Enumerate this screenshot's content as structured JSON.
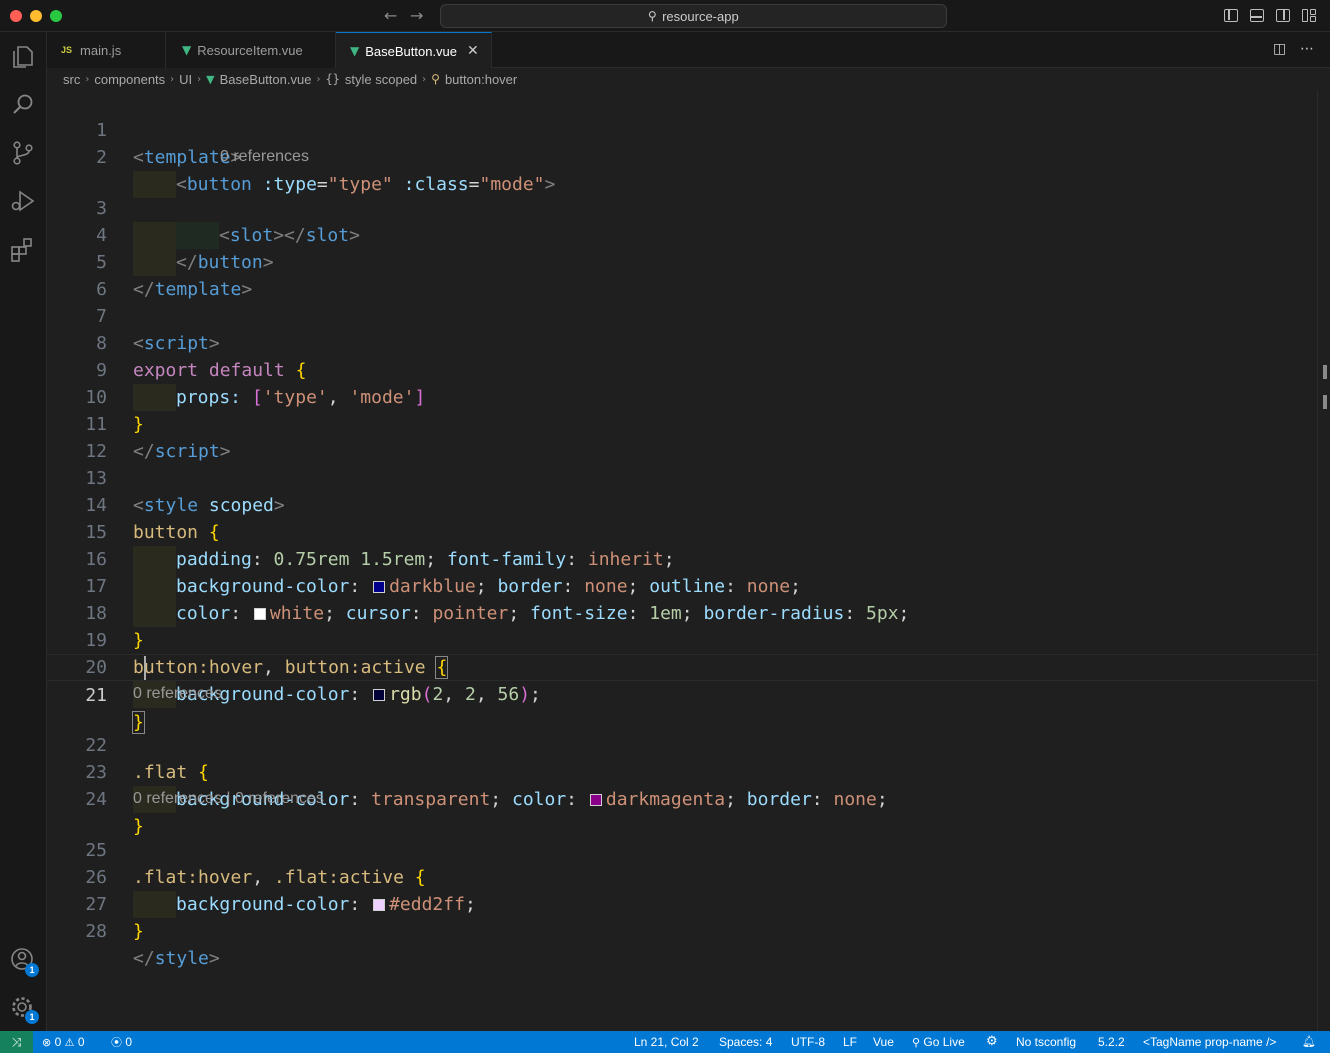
{
  "window": {
    "search_text": "resource-app"
  },
  "tabs": [
    {
      "label": "main.js",
      "icon": "js-icon",
      "badge": "JS"
    },
    {
      "label": "ResourceItem.vue",
      "icon": "vue-icon"
    },
    {
      "label": "BaseButton.vue",
      "icon": "vue-icon",
      "active": true
    }
  ],
  "breadcrumb": {
    "items": [
      "src",
      "components",
      "UI",
      "BaseButton.vue",
      "style scoped",
      "button:hover"
    ],
    "brace_glyph": "{}"
  },
  "codelens": {
    "line2": "0 references",
    "line21": "0 references",
    "line24": "0 references | 0 references"
  },
  "line_numbers": [
    "1",
    "2",
    "3",
    "4",
    "5",
    "6",
    "7",
    "8",
    "9",
    "10",
    "11",
    "12",
    "13",
    "14",
    "15",
    "16",
    "17",
    "18",
    "19",
    "20",
    "21",
    "22",
    "23",
    "24",
    "25",
    "26",
    "27",
    "28"
  ],
  "code": {
    "l1": {
      "lt": "<",
      "tag": "template",
      "gt": ">"
    },
    "l2": {
      "lt": "<",
      "tag": "button",
      "a1": ":type",
      "eq1": "=",
      "v1": "\"type\"",
      "a2": ":class",
      "eq2": "=",
      "v2": "\"mode\"",
      "gt": ">"
    },
    "l3": {
      "lt": "<",
      "tag": "slot",
      "mid": "></",
      "tag2": "slot",
      "gt": ">"
    },
    "l4": {
      "lt": "</",
      "tag": "button",
      "gt": ">"
    },
    "l5": {
      "lt": "</",
      "tag": "template",
      "gt": ">"
    },
    "l7": {
      "lt": "<",
      "tag": "script",
      "gt": ">"
    },
    "l8": {
      "kw": "export default",
      "brace": "{"
    },
    "l9": {
      "prop": "props:",
      "open": "[",
      "s1": "'type'",
      "comma": ",",
      "s2": "'mode'",
      "close": "]"
    },
    "l10": {
      "brace": "}"
    },
    "l11": {
      "lt": "</",
      "tag": "script",
      "gt": ">"
    },
    "l13": {
      "lt": "<",
      "tag": "style",
      "attr": "scoped",
      "gt": ">"
    },
    "l14": {
      "sel": "button",
      "brace": "{"
    },
    "l15": {
      "p1": "padding",
      "v1a": "0.75rem",
      "v1b": "1.5rem",
      "p2": "font-family",
      "v2": "inherit"
    },
    "l16": {
      "p1": "background-color",
      "v1": "darkblue",
      "p2": "border",
      "v2": "none",
      "p3": "outline",
      "v3": "none"
    },
    "l17": {
      "p1": "color",
      "v1": "white",
      "p2": "cursor",
      "v2": "pointer",
      "p3": "font-size",
      "v3": "1em",
      "p4": "border-radius",
      "v4": "5px"
    },
    "l18": {
      "brace": "}"
    },
    "l19": {
      "sel1": "button:hover",
      "comma": ",",
      "sel2": "button:active",
      "brace": "{"
    },
    "l20": {
      "p1": "background-color",
      "fn": "rgb",
      "args": [
        "2",
        "2",
        "56"
      ]
    },
    "l21": {
      "brace": "}"
    },
    "l22": {
      "sel": ".flat",
      "brace": "{"
    },
    "l23": {
      "p1": "background-color",
      "v1": "transparent",
      "p2": "color",
      "v2": "darkmagenta",
      "p3": "border",
      "v3": "none"
    },
    "l24": {
      "brace": "}"
    },
    "l25": {
      "sel1": ".flat:hover",
      "comma": ",",
      "sel2": ".flat:active",
      "brace": "{"
    },
    "l26": {
      "p1": "background-color",
      "v1": "#edd2ff"
    },
    "l27": {
      "brace": "}"
    },
    "l28": {
      "lt": "</",
      "tag": "style",
      "gt": ">"
    }
  },
  "swatches": {
    "darkblue": "#00008b",
    "white": "#ffffff",
    "rgb": "#020238",
    "darkmagenta": "#8b008b",
    "edd2ff": "#edd2ff"
  },
  "statusbar": {
    "errors": "0",
    "warnings": "0",
    "ports": "0",
    "position": "Ln 21, Col 2",
    "spaces": "Spaces: 4",
    "encoding": "UTF-8",
    "eol": "LF",
    "language": "Vue",
    "golive": "Go Live",
    "tsconfig": "No tsconfig",
    "version": "5.2.2",
    "snippet": "<TagName prop-name />"
  },
  "activity_badges": {
    "accounts": "1",
    "settings": "1"
  },
  "colors": {
    "accent": "#0078d4",
    "remote": "#16825d",
    "vue": "#41b883"
  }
}
